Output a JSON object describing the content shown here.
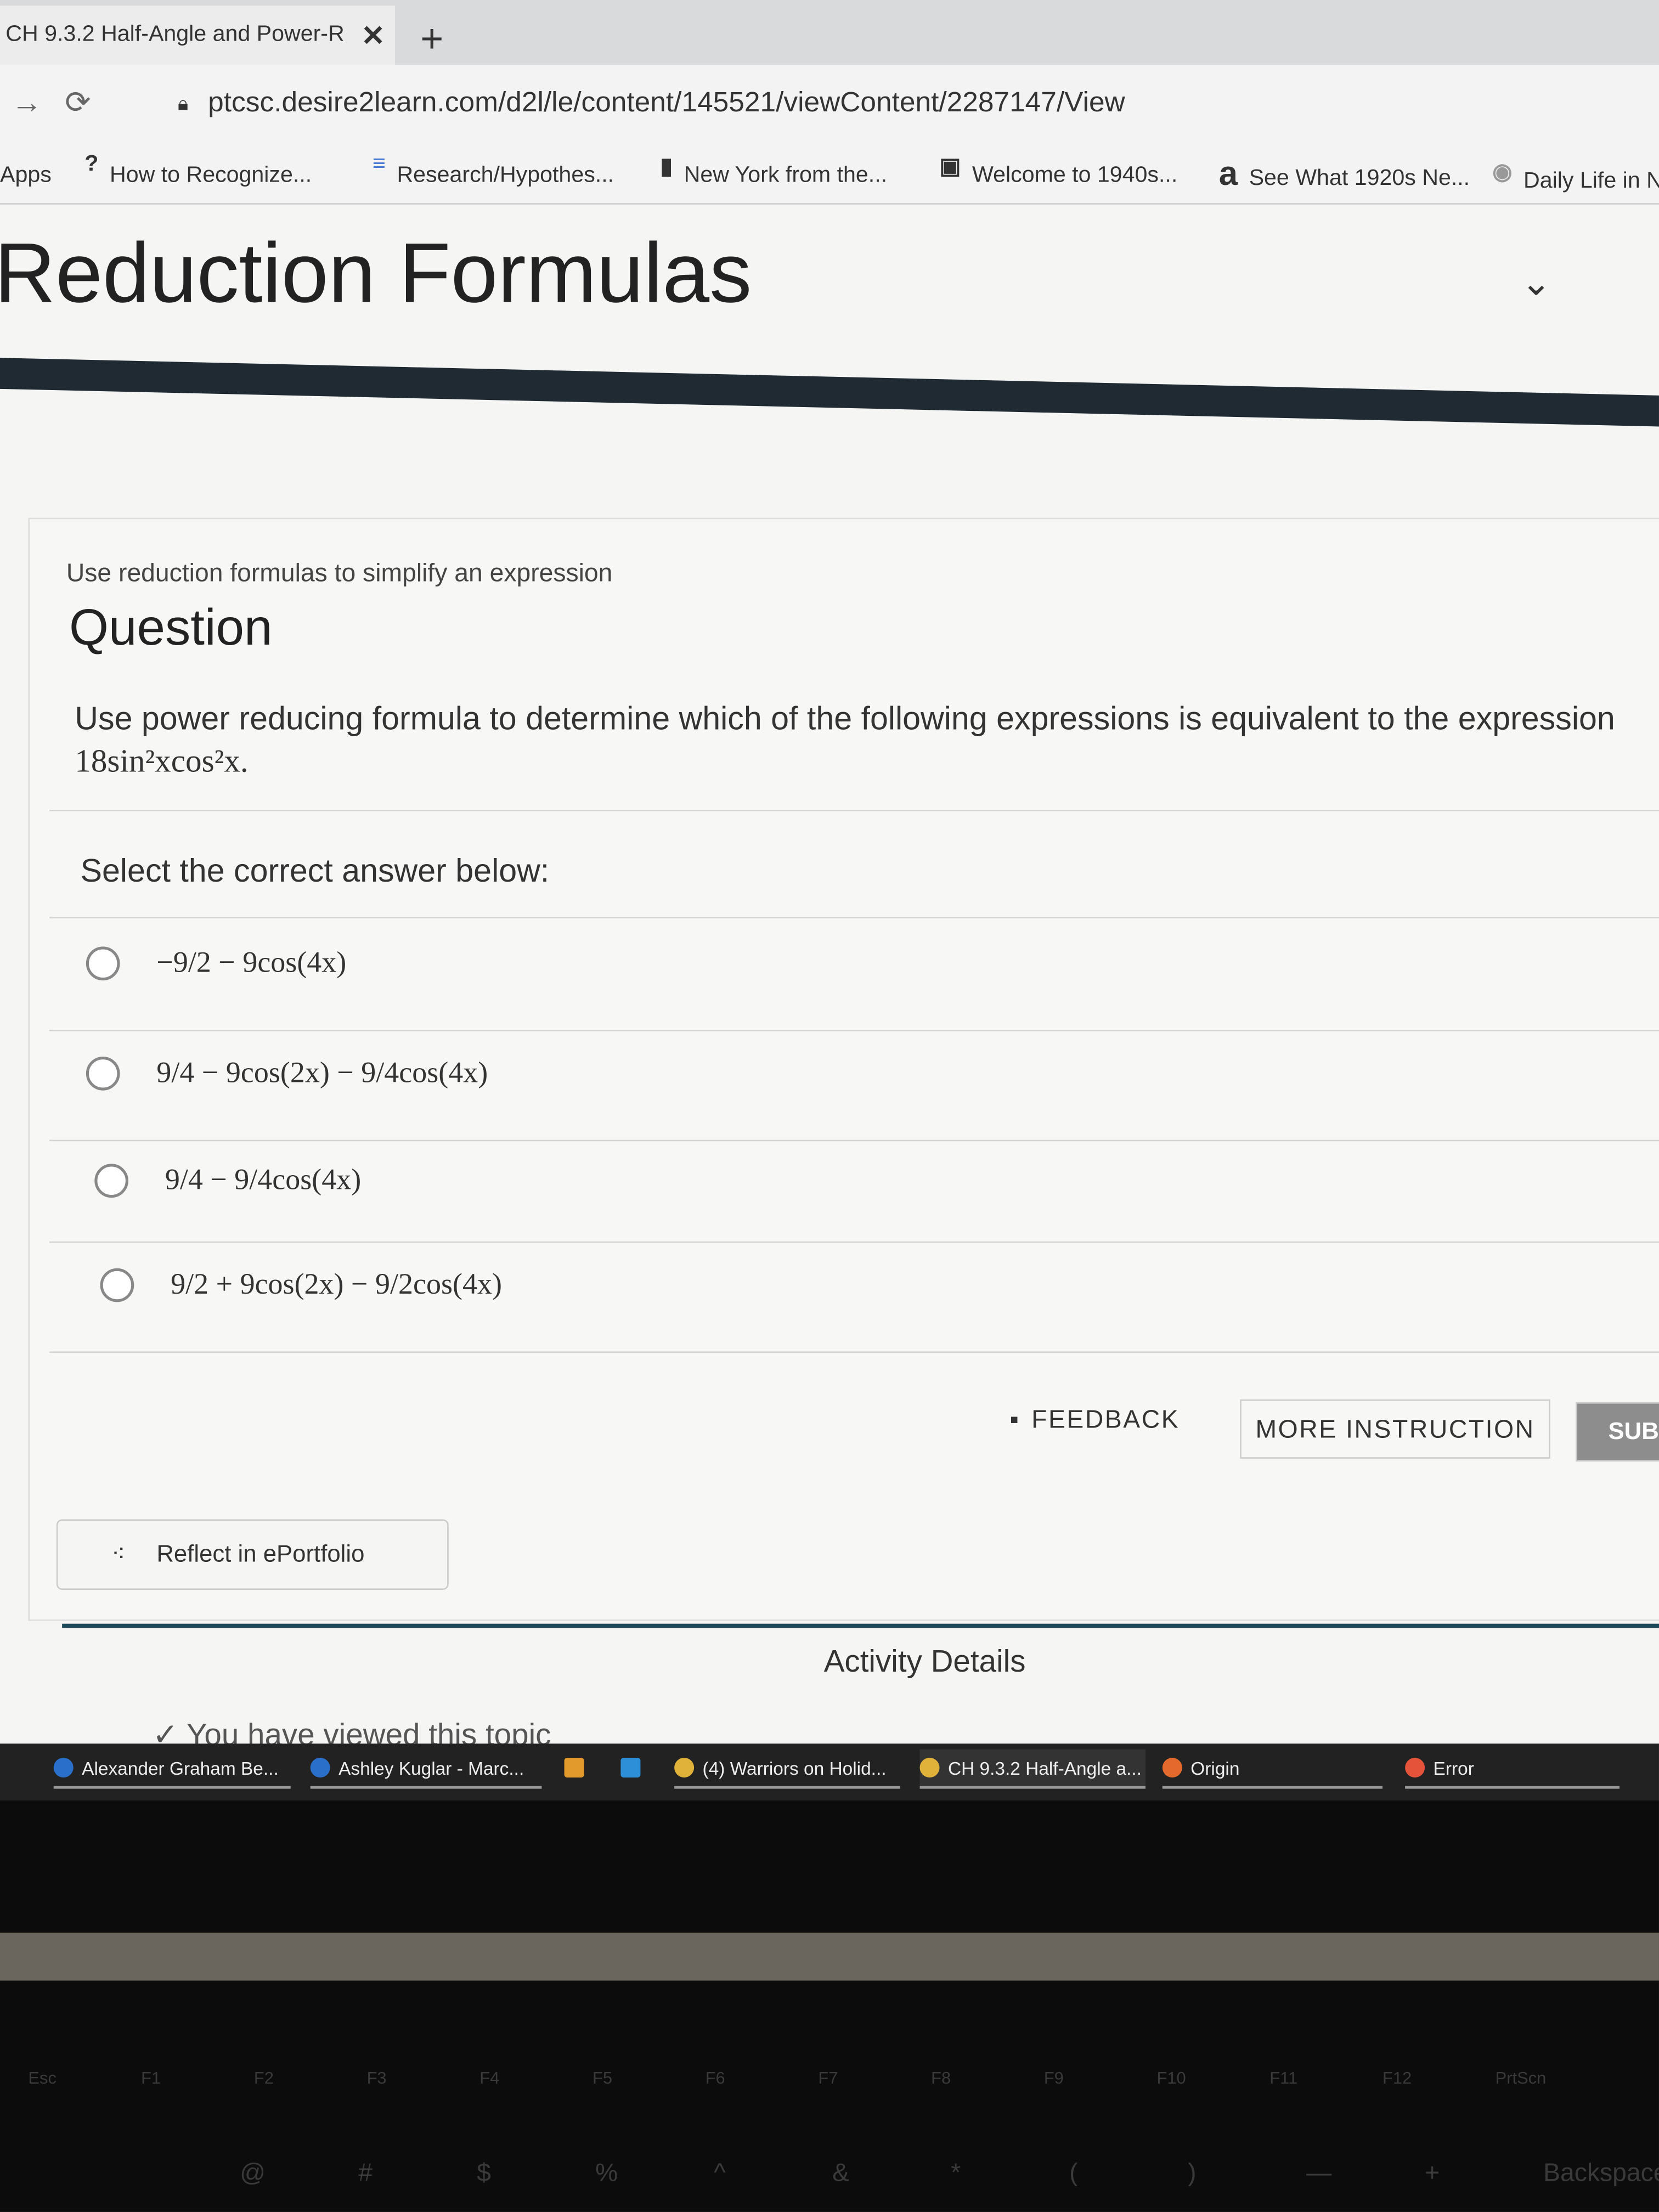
{
  "browser": {
    "tab_title": "CH 9.3.2 Half-Angle and Power-R",
    "tab_close": "✕",
    "new_tab": "+",
    "url": "ptcsc.desire2learn.com/d2l/le/content/145521/viewContent/2287147/View",
    "bookmarks": [
      {
        "icon": "",
        "label": "Apps"
      },
      {
        "icon": "?",
        "label": "How to Recognize..."
      },
      {
        "icon": "≡",
        "label": "Research/Hypothes..."
      },
      {
        "icon": "▮",
        "label": "New York from the..."
      },
      {
        "icon": "▣",
        "label": "Welcome to 1940s..."
      },
      {
        "icon": "a",
        "label": "See What 1920s Ne..."
      },
      {
        "icon": "◉",
        "label": "Daily Life in N"
      }
    ]
  },
  "page": {
    "title": "Reduction Formulas",
    "collapse_icon": "chevron-down"
  },
  "question": {
    "subtitle": "Use reduction formulas to simplify an expression",
    "heading": "Question",
    "text": "Use power reducing formula to determine which of the following expressions is equivalent to the expression",
    "expression": "18sin²xcos²x.",
    "prompt": "Select the correct answer below:",
    "options": [
      {
        "label": "−9/2 − 9cos(4x)",
        "selected": false
      },
      {
        "label": "9/4 − 9cos(2x) − 9/4cos(4x)",
        "selected": false
      },
      {
        "label": "9/4 − 9/4cos(4x)",
        "selected": false
      },
      {
        "label": "9/2 + 9cos(2x) − 9/2cos(4x)",
        "selected": false
      }
    ]
  },
  "buttons": {
    "feedback": "FEEDBACK",
    "more_instruction": "MORE INSTRUCTION",
    "submit": "SUB"
  },
  "reflect": "Reflect in ePortfolio",
  "activity": {
    "title": "Activity Details",
    "viewed": "You have viewed this topic"
  },
  "taskbar": [
    {
      "label": "Alexander Graham Be...",
      "icon": "ie"
    },
    {
      "label": "Ashley Kuglar - Marc...",
      "icon": "ie"
    },
    {
      "label": "(4) Warriors on Holid...",
      "icon": "chrome"
    },
    {
      "label": "CH 9.3.2 Half-Angle a...",
      "icon": "chrome"
    },
    {
      "label": "Origin",
      "icon": "origin"
    },
    {
      "label": "Error",
      "icon": "error"
    }
  ],
  "keyboard": {
    "fkeys": [
      "Esc",
      "F1",
      "F2",
      "F3",
      "F4",
      "F5",
      "F6",
      "F7",
      "F8",
      "F9",
      "F10",
      "F11",
      "F12",
      "PrtScn"
    ],
    "numrow": [
      "@",
      "#",
      "$",
      "%",
      "^",
      "&",
      "*",
      "(",
      ")",
      "—",
      "+",
      "Backspace"
    ]
  },
  "colors": {
    "dark_bar": "#1f2a33",
    "teal_bar": "#1d4a5a",
    "taskbar": "#222222"
  }
}
